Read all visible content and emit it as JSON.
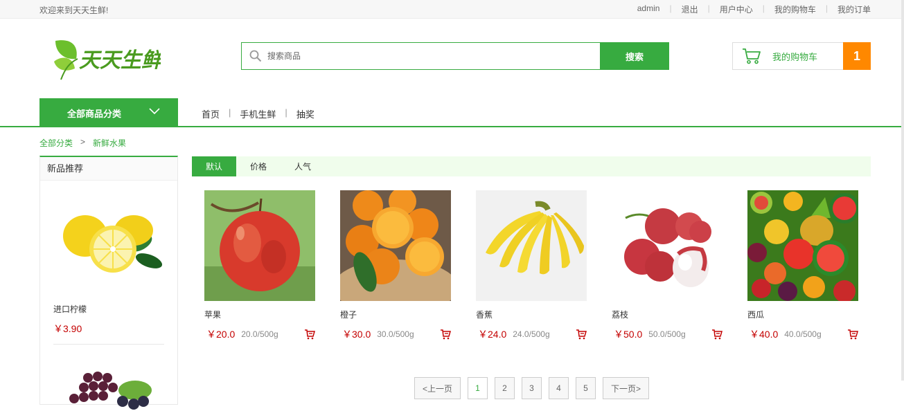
{
  "topbar": {
    "welcome": "欢迎来到天天生鲜!",
    "links": [
      "admin",
      "退出",
      "用户中心",
      "我的购物车",
      "我的订单"
    ]
  },
  "header": {
    "logo_text": "天天生鲜",
    "search": {
      "placeholder": "搜索商品",
      "button": "搜索"
    },
    "cart": {
      "label": "我的购物车",
      "count": "1"
    }
  },
  "nav": {
    "all_categories": "全部商品分类",
    "menu": [
      "首页",
      "手机生鲜",
      "抽奖"
    ]
  },
  "breadcrumb": {
    "root": "全部分类",
    "separator": ">",
    "current": "新鲜水果"
  },
  "sidebar": {
    "title": "新品推荐",
    "items": [
      {
        "name": "进口柠檬",
        "price": "￥3.90"
      }
    ]
  },
  "sort": {
    "options": [
      "默认",
      "价格",
      "人气"
    ],
    "active": "默认"
  },
  "goods": [
    {
      "name": "苹果",
      "price": "￥20.0",
      "unit": "20.0/500g"
    },
    {
      "name": "橙子",
      "price": "￥30.0",
      "unit": "30.0/500g"
    },
    {
      "name": "香蕉",
      "price": "￥24.0",
      "unit": "24.0/500g"
    },
    {
      "name": "荔枝",
      "price": "￥50.0",
      "unit": "50.0/500g"
    },
    {
      "name": "西瓜",
      "price": "￥40.0",
      "unit": "40.0/500g"
    }
  ],
  "pagination": {
    "prev": "<上一页",
    "pages": [
      "1",
      "2",
      "3",
      "4",
      "5"
    ],
    "current": "1",
    "next": "下一页>"
  },
  "colors": {
    "brand_green": "#37ab40",
    "cart_orange": "#ff8800",
    "price_red": "#c40000"
  }
}
